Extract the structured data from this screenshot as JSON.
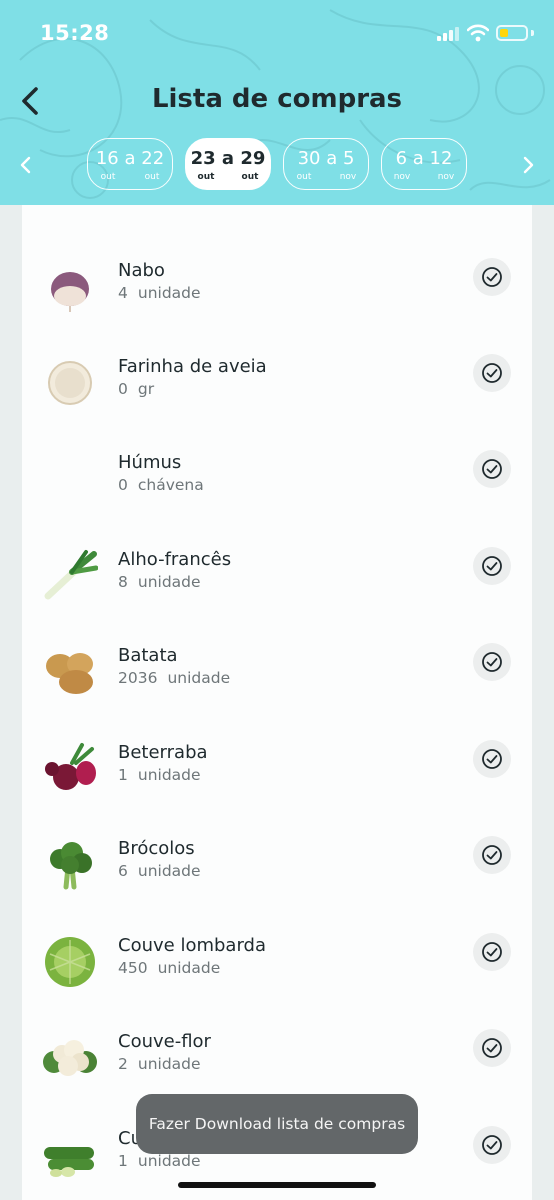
{
  "status_bar": {
    "time": "15:28",
    "battery_color": "#ffd60a",
    "battery_level": 0.35
  },
  "header": {
    "title": "Lista de compras",
    "background": "#7fdfe6",
    "back_icon": "chevron-left-icon",
    "prev_icon": "chevron-left-icon",
    "next_icon": "chevron-right-icon"
  },
  "weeks": [
    {
      "range_from": "16",
      "range_sep": "a",
      "range_to": "22",
      "month_from": "out",
      "month_to": "out",
      "active": false
    },
    {
      "range_from": "23",
      "range_sep": "a",
      "range_to": "29",
      "month_from": "out",
      "month_to": "out",
      "active": true
    },
    {
      "range_from": "30",
      "range_sep": "a",
      "range_to": "5",
      "month_from": "out",
      "month_to": "nov",
      "active": false
    },
    {
      "range_from": "6",
      "range_sep": "a",
      "range_to": "12",
      "month_from": "nov",
      "month_to": "nov",
      "active": false
    }
  ],
  "items": [
    {
      "name": "Nabo",
      "qty": "4",
      "unit": "unidade",
      "icon": "turnip-icon"
    },
    {
      "name": "Farinha de aveia",
      "qty": "0",
      "unit": "gr",
      "icon": "oat-flour-icon"
    },
    {
      "name": "Húmus",
      "qty": "0",
      "unit": "chávena",
      "icon": ""
    },
    {
      "name": "Alho-francês",
      "qty": "8",
      "unit": "unidade",
      "icon": "leek-icon"
    },
    {
      "name": "Batata",
      "qty": "2036",
      "unit": "unidade",
      "icon": "potato-icon"
    },
    {
      "name": "Beterraba",
      "qty": "1",
      "unit": "unidade",
      "icon": "beetroot-icon"
    },
    {
      "name": "Brócolos",
      "qty": "6",
      "unit": "unidade",
      "icon": "broccoli-icon"
    },
    {
      "name": "Couve lombarda",
      "qty": "450",
      "unit": "unidade",
      "icon": "savoy-cabbage-icon"
    },
    {
      "name": "Couve-flor",
      "qty": "2",
      "unit": "unidade",
      "icon": "cauliflower-icon"
    },
    {
      "name": "Cu",
      "qty": "1",
      "unit": "unidade",
      "icon": "zucchini-icon"
    }
  ],
  "toast": {
    "text": "Fazer Download lista de compras"
  }
}
